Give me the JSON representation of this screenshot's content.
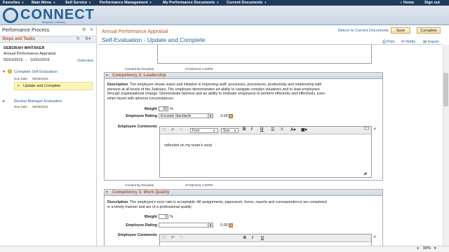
{
  "topnav": {
    "items": [
      "Favorites",
      "Main Menu",
      "Self Service",
      "Performance Management",
      "My Performance Documents",
      "Current Documents"
    ],
    "home": "Home",
    "signout": "Sign out"
  },
  "banner": {
    "logo": "CONNECT",
    "subtitle": "Maryland Judiciary"
  },
  "left": {
    "title": "Performance Process",
    "steps_label": "Steps and Tasks",
    "employee": "DEBORAH WHITAKER",
    "doc_type": "Annual Performance Appraisal",
    "period_start": "02/01/2015",
    "period_sep": "-",
    "period_end": "10/01/2015",
    "overview": "Overview",
    "step1": {
      "label": "Complete Self Evaluation",
      "due_label": "Due Date",
      "due": "09/28/2015"
    },
    "current": "Update and Complete",
    "step2": {
      "label": "Review Manager Evaluation",
      "due_label": "Due Date",
      "due": "09/29/2015"
    }
  },
  "header": {
    "app_title": "Annual Performance Appraisal",
    "page_title": "Self-Evaluation - Update and Complete",
    "return_link": "Return to Current Documents",
    "save": "Save",
    "complete": "Complete",
    "print": "Print",
    "notify": "Notify",
    "export": "Export"
  },
  "top_meta": {
    "created_by_label": "Created By",
    "created_by": "Template",
    "timestamp": "07/28/2015 1:00PM"
  },
  "comp2": {
    "heading": "Competency 2: Leadership",
    "desc_label": "Description",
    "desc": ": The employee shows vision and initiative in improving staff, processes, procedures, productivity and relationship with persons at all levels of the Judiciary. The employee demonstrates an ability to navigate complex situations and to lead employees through organizational change. Demonstrate fairness and an ability to motivate employees to perform efficiently and effectively, even when faced with adverse circumstances.",
    "weight_label": "Weight",
    "weight": "20",
    "pct": "%",
    "rating_label": "Employee Rating",
    "rating": "Exceeds Standards",
    "score": "3.00",
    "comments_label": "Employee Comments",
    "font": "Font",
    "size": "Size",
    "comment_text": "reflected on my team's work",
    "created_by_label": "Created By",
    "created_by": "Template",
    "timestamp": "07/28/2015 1:00PM"
  },
  "comp3": {
    "heading": "Competency 3: Work Quality",
    "desc_label": "Description",
    "desc": ": The employee's error rate is acceptable. All assignments, paperwork, forms, reports and correspondence are completed in a timely manner and are of a professional quality.",
    "weight_label": "Weight",
    "weight": "0",
    "pct": "%",
    "rating_label": "Employee Rating",
    "rating": "",
    "score": "0.00",
    "comments_label": "Employee Comments"
  },
  "status": {
    "zoom": "90%"
  }
}
